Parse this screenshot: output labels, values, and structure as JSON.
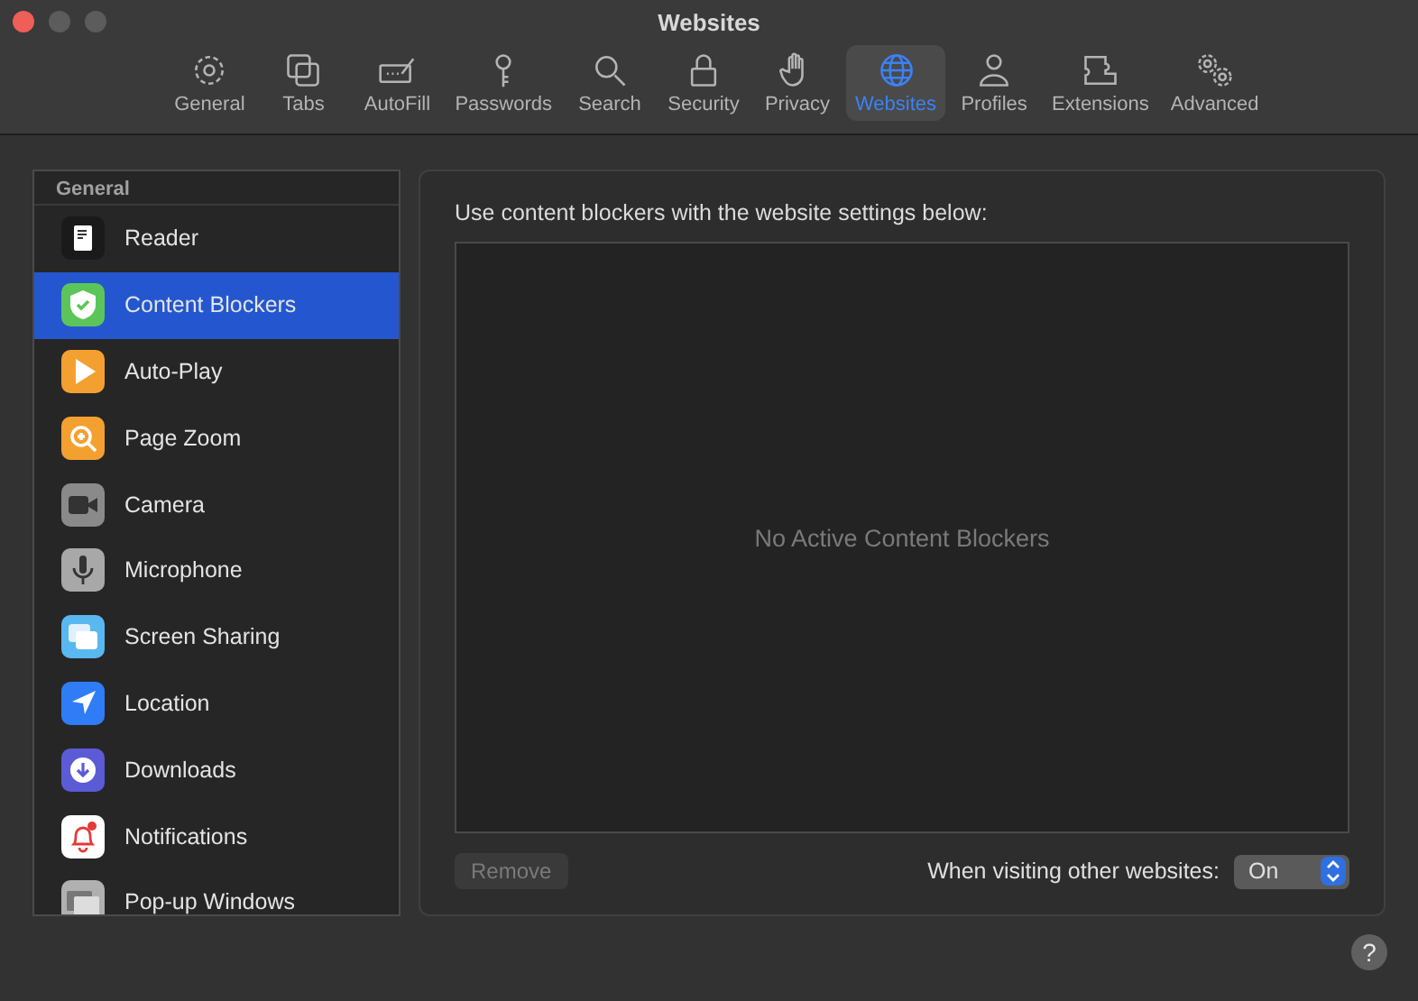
{
  "window": {
    "title": "Websites"
  },
  "toolbar": [
    {
      "label": "General",
      "kind": "gear",
      "selected": false
    },
    {
      "label": "Tabs",
      "kind": "tabs",
      "selected": false
    },
    {
      "label": "AutoFill",
      "kind": "autofill",
      "selected": false
    },
    {
      "label": "Passwords",
      "kind": "key",
      "selected": false
    },
    {
      "label": "Search",
      "kind": "search",
      "selected": false
    },
    {
      "label": "Security",
      "kind": "lock",
      "selected": false
    },
    {
      "label": "Privacy",
      "kind": "hand",
      "selected": false
    },
    {
      "label": "Websites",
      "kind": "globe",
      "selected": true
    },
    {
      "label": "Profiles",
      "kind": "person",
      "selected": false
    },
    {
      "label": "Extensions",
      "kind": "puzzle",
      "selected": false
    },
    {
      "label": "Advanced",
      "kind": "gears",
      "selected": false
    }
  ],
  "sidebar": {
    "header": "General",
    "items": [
      {
        "label": "Reader",
        "kind": "reader",
        "selected": false
      },
      {
        "label": "Content Blockers",
        "kind": "shield",
        "selected": true
      },
      {
        "label": "Auto-Play",
        "kind": "play",
        "selected": false
      },
      {
        "label": "Page Zoom",
        "kind": "zoom",
        "selected": false
      },
      {
        "label": "Camera",
        "kind": "camera",
        "selected": false
      },
      {
        "label": "Microphone",
        "kind": "mic",
        "selected": false
      },
      {
        "label": "Screen Sharing",
        "kind": "screens",
        "selected": false
      },
      {
        "label": "Location",
        "kind": "location",
        "selected": false
      },
      {
        "label": "Downloads",
        "kind": "download",
        "selected": false
      },
      {
        "label": "Notifications",
        "kind": "bell",
        "selected": false
      },
      {
        "label": "Pop-up Windows",
        "kind": "popup",
        "selected": false
      }
    ]
  },
  "panel": {
    "heading": "Use content blockers with the website settings below:",
    "empty_message": "No Active Content Blockers",
    "remove_button": {
      "label": "Remove",
      "disabled": true
    },
    "other_websites": {
      "label": "When visiting other websites:",
      "value": "On"
    }
  },
  "help_button": "?"
}
